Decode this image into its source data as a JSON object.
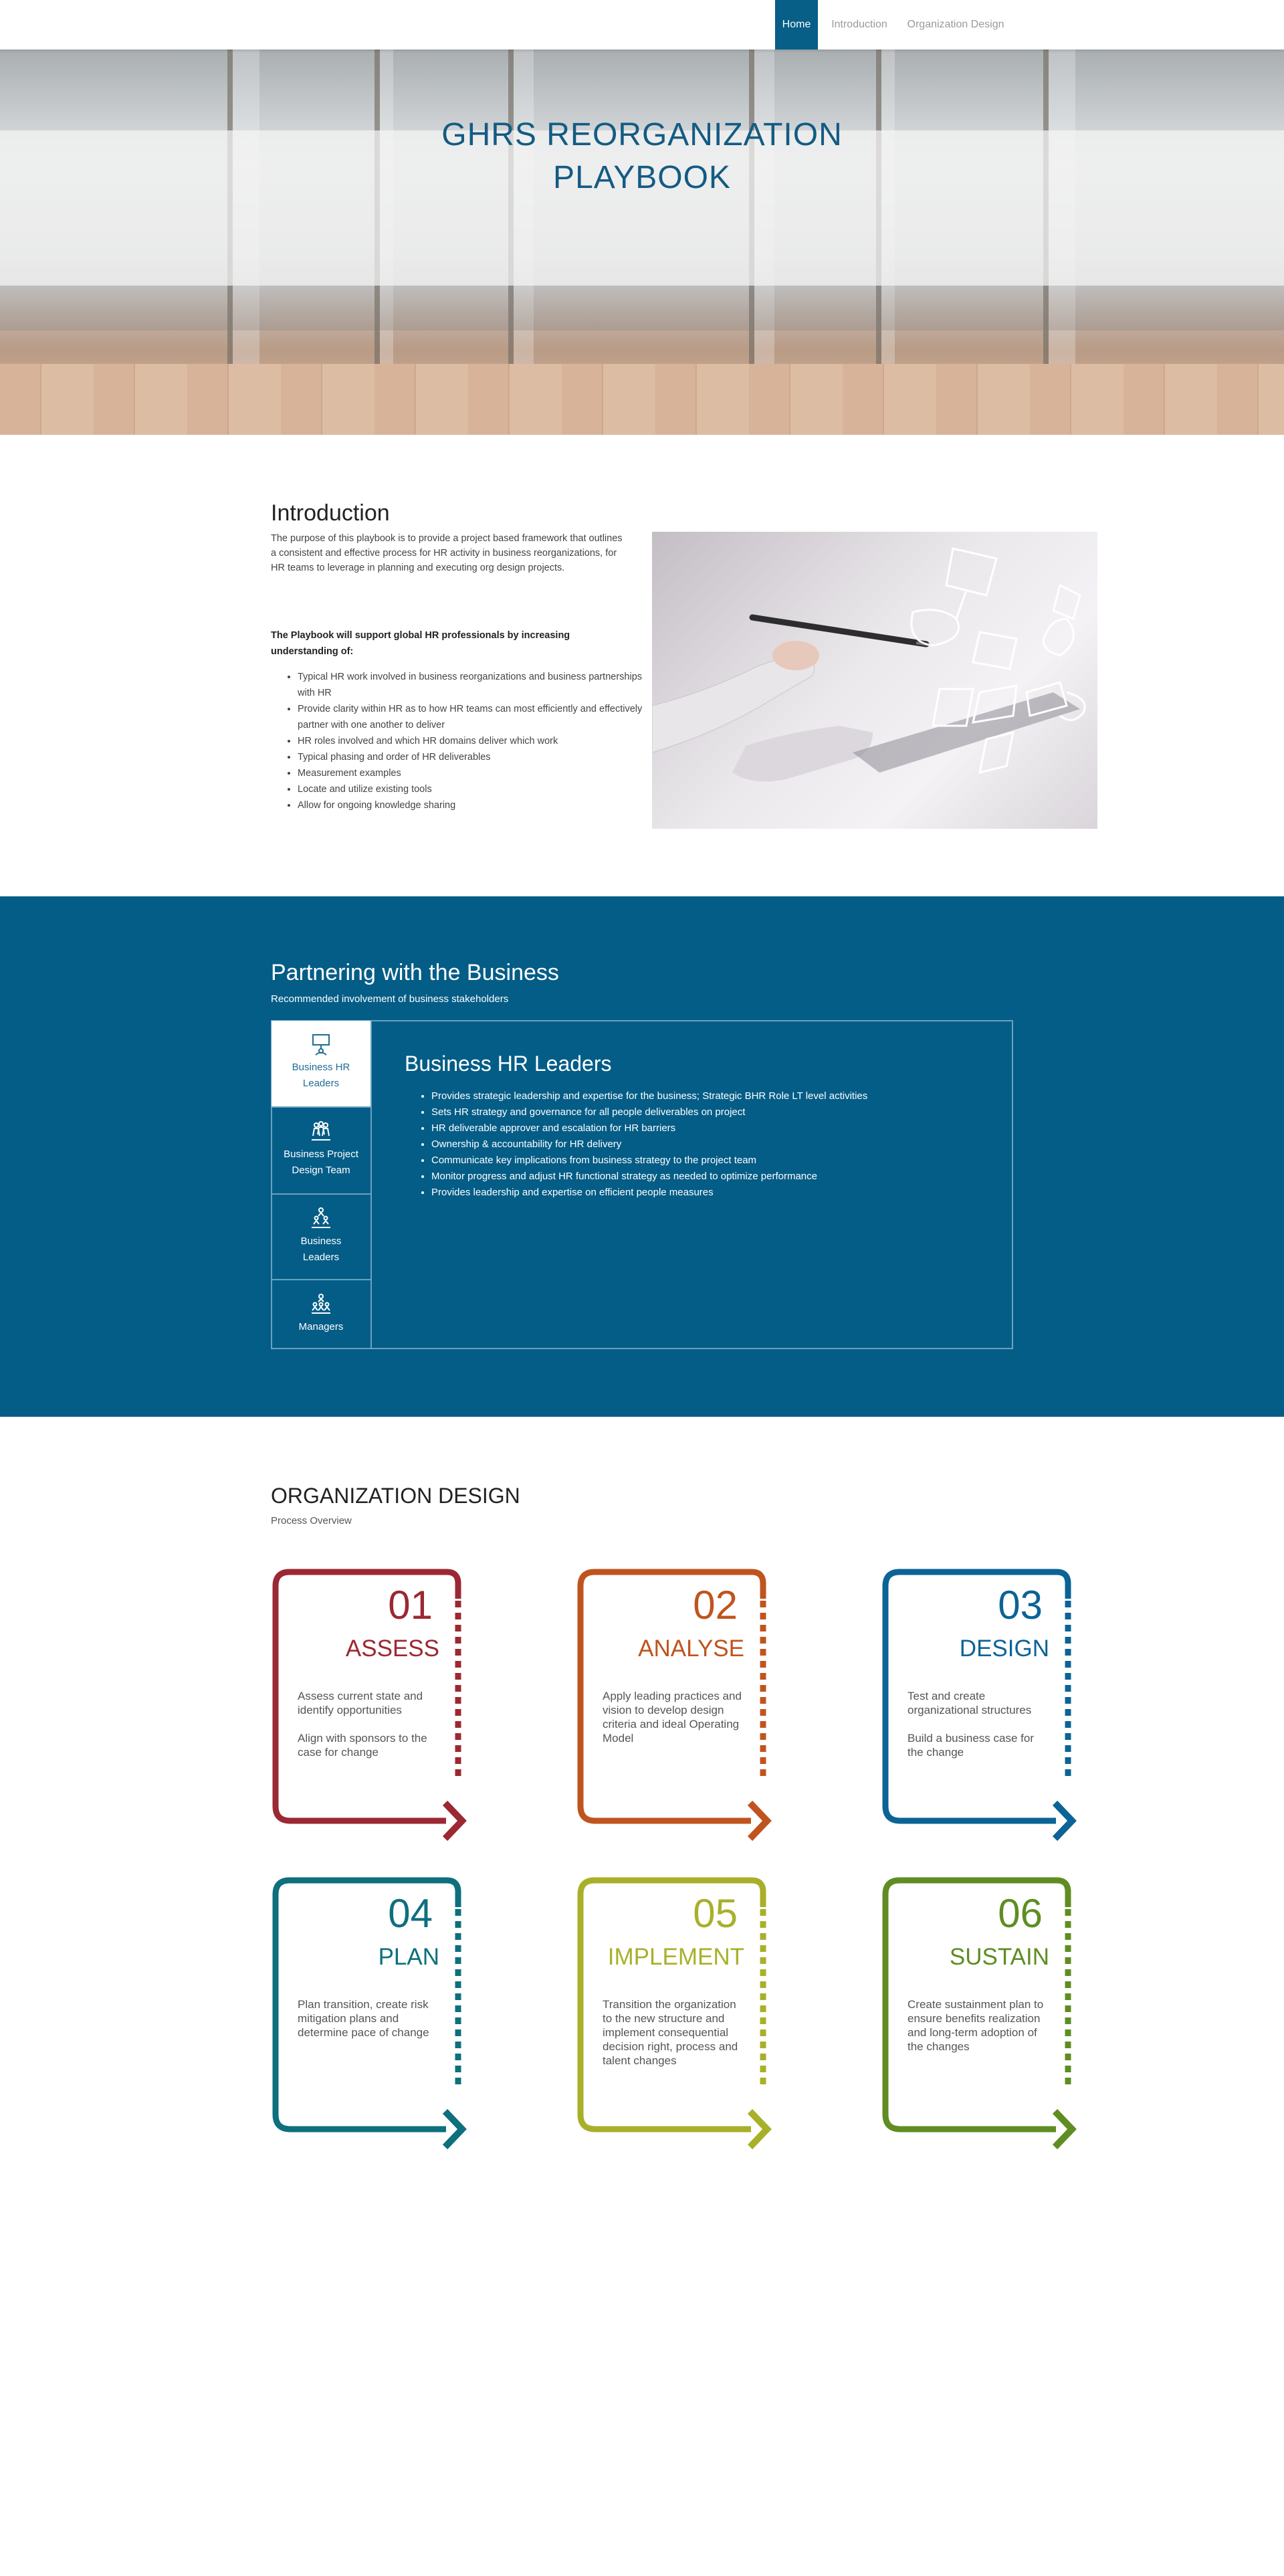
{
  "nav": {
    "home": "Home",
    "introduction": "Introduction",
    "organization_design": "Organization Design"
  },
  "hero": {
    "title_line1": "GHRS REORGANIZATION",
    "title_line2": "PLAYBOOK"
  },
  "intro": {
    "title": "Introduction",
    "paragraph": "The purpose of this playbook is to provide a project based framework that outlines a consistent and effective process for HR activity in business reorganizations, for HR teams to leverage in planning and executing org design projects.",
    "bold": "The Playbook will support global HR professionals by increasing understanding of:",
    "items": [
      "Typical HR work involved in business reorganizations and business partnerships with HR",
      "Provide clarity within HR as to how HR teams can most efficiently and effectively partner with one another to deliver",
      "HR roles involved and which HR domains deliver which work",
      "Typical phasing and order of HR deliverables",
      "Measurement examples",
      "Locate and utilize existing tools",
      "Allow for ongoing knowledge sharing"
    ]
  },
  "partner": {
    "title": "Partnering with the Business",
    "subtitle": "Recommended involvement of business stakeholders",
    "tabs": [
      {
        "label_line1": "Business HR",
        "label_line2": "Leaders",
        "icon": "presenter-icon"
      },
      {
        "label_line1": "Business Project",
        "label_line2": "Design Team",
        "icon": "team-icon"
      },
      {
        "label_line1": "Business",
        "label_line2": "Leaders",
        "icon": "hierarchy-icon"
      },
      {
        "label_line1": "Managers",
        "label_line2": "",
        "icon": "group-icon"
      }
    ],
    "panel_title": "Business HR Leaders",
    "panel_items": [
      "Provides strategic leadership and expertise for the business; Strategic BHR Role LT level activities",
      "Sets HR strategy and governance for all people deliverables on project",
      "HR deliverable approver and escalation for HR barriers",
      "Ownership & accountability for HR delivery",
      "Communicate key implications from business strategy to the project team",
      "Monitor progress and adjust HR functional strategy as needed to optimize performance",
      "Provides leadership and expertise on efficient people measures"
    ]
  },
  "org": {
    "title": "ORGANIZATION DESIGN",
    "subtitle": "Process Overview",
    "cards": [
      {
        "num": "01",
        "name": "ASSESS",
        "color": "#9b2832",
        "desc": "Assess current state and identify opportunities\n\nAlign with sponsors to the case for change"
      },
      {
        "num": "02",
        "name": "ANALYSE",
        "color": "#c0541e",
        "desc": "Apply leading practices and vision to develop design criteria and ideal Operating Model"
      },
      {
        "num": "03",
        "name": "DESIGN",
        "color": "#0b6396",
        "desc": "Test and create organizational structures\n\n Build a business case for the change"
      },
      {
        "num": "04",
        "name": "PLAN",
        "color": "#0e6f7d",
        "desc": "Plan transition, create risk mitigation plans and determine pace of change"
      },
      {
        "num": "05",
        "name": "IMPLEMENT",
        "color": "#a8b02a",
        "desc": "Transition the organization to the new structure and implement consequential decision right, process and talent changes"
      },
      {
        "num": "06",
        "name": "SUSTAIN",
        "color": "#5f8d22",
        "desc": "Create sustainment plan to ensure benefits realization and long-term adoption of the changes"
      }
    ]
  }
}
